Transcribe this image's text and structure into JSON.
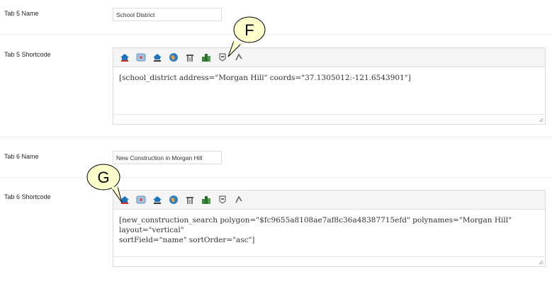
{
  "tab5": {
    "name_label": "Tab 5 Name",
    "name_value": "School District",
    "shortcode_label": "Tab 5 Shortcode",
    "shortcode_value": "[school_district address=\"Morgan Hill\" coords=\"37.1305012:-121.6543901\"]"
  },
  "tab6": {
    "name_label": "Tab 6 Name",
    "name_value": "New Construction in Morgan Hill",
    "shortcode_label": "Tab 6 Shortcode",
    "shortcode_line1": "[new_construction_search polygon=\"$fc9655a8108ae7af8c36a48387715efd\" polynames=\"Morgan Hill\" layout=\"vertical\"",
    "shortcode_line2": "sortField=\"name\" sortOrder=\"asc\"]"
  },
  "callouts": {
    "f": "F",
    "g": "G"
  },
  "toolbar_icons": [
    "house-idx-icon",
    "map-icon",
    "idx-house-icon",
    "globe-icon",
    "building-icon",
    "city-icon",
    "badge-icon",
    "arrow-up-icon"
  ],
  "colors": {
    "callout_fill": "#ffffcc",
    "toolbar_bg": "#f5f5f5"
  }
}
